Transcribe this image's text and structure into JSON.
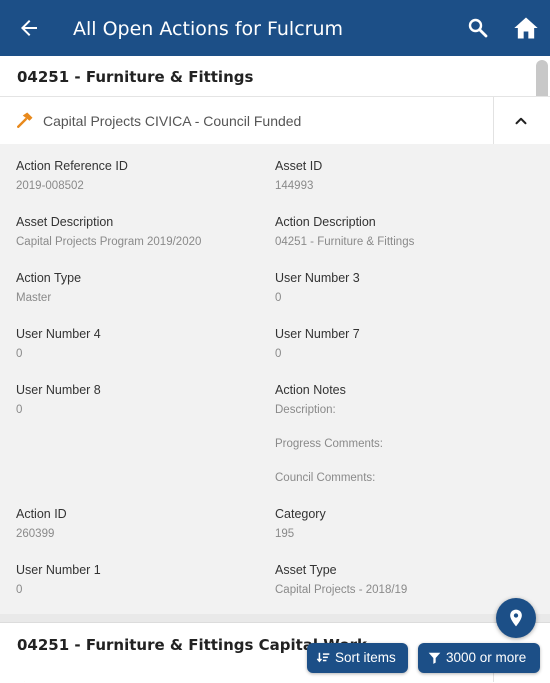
{
  "colors": {
    "primary": "#1c4f87",
    "detail_bg": "#f2f2f2",
    "accent_orange": "#e8891c"
  },
  "appbar": {
    "title": "All Open Actions for Fulcrum",
    "back_icon": "arrow-left-icon",
    "search_icon": "search-icon",
    "home_icon": "home-icon"
  },
  "card1": {
    "title": "04251 - Furniture & Fittings",
    "subtitle": "Capital Projects CIVICA - Council Funded",
    "subtitle_icon": "hammer-icon",
    "toggle_icon": "chevron-up-icon",
    "fields": [
      {
        "label": "Action Reference ID",
        "value": "2019-008502"
      },
      {
        "label": "Asset ID",
        "value": "144993"
      },
      {
        "label": "Asset Description",
        "value": "Capital Projects Program 2019/2020"
      },
      {
        "label": "Action Description",
        "value": "04251 - Furniture & Fittings"
      },
      {
        "label": "Action Type",
        "value": "Master"
      },
      {
        "label": "User Number 3",
        "value": "0"
      },
      {
        "label": "User Number 4",
        "value": "0"
      },
      {
        "label": "User Number 7",
        "value": "0"
      },
      {
        "label": "User Number 8",
        "value": "0"
      },
      {
        "label": "Action Notes",
        "value": "Description:",
        "value2": "Progress Comments:",
        "value3": "Council Comments:"
      },
      {
        "label": "Action ID",
        "value": "260399"
      },
      {
        "label": "Category",
        "value": "195"
      },
      {
        "label": "User Number 1",
        "value": "0"
      },
      {
        "label": "Asset Type",
        "value": "Capital Projects - 2018/19"
      }
    ]
  },
  "card2": {
    "title": "04251 - Furniture & Fittings Capital Work"
  },
  "fab": {
    "icon": "map-marker-icon"
  },
  "actions": {
    "sort_label": "Sort items",
    "sort_icon": "sort-icon",
    "filter_label": "3000 or more",
    "filter_icon": "filter-icon"
  }
}
